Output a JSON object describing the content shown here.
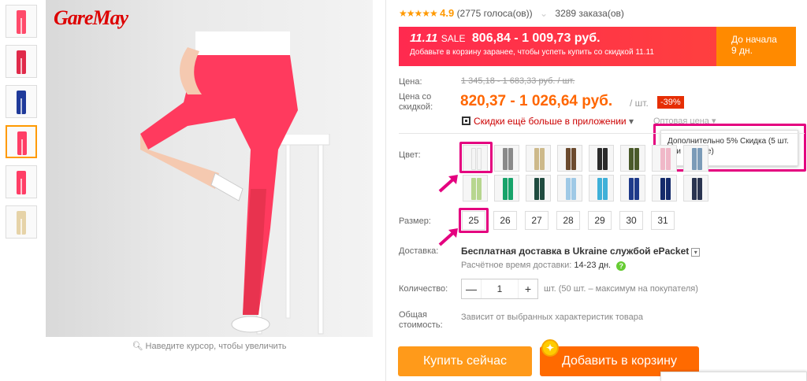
{
  "brand": "GareMay",
  "zoom_hint": "Наведите курсор, чтобы увеличить",
  "rating": {
    "stars": "★★★★★",
    "score": "4.9",
    "votes": "(2775 голоса(ов))",
    "orders": "3289 заказа(ов)"
  },
  "sale": {
    "badge": "11.11",
    "sale_label": "SALE",
    "price": "806,84 - 1 009,73 руб.",
    "subtitle": "Добавьте в корзину заранее, чтобы успеть купить со скидкой 11.11",
    "countdown_label": "До начала",
    "countdown_value": "9 дн."
  },
  "price": {
    "label": "Цена:",
    "old": "1 345,18 - 1 683,33 руб. / шт.",
    "discount_label": "Цена со скидкой:",
    "new": "820,37 - 1 026,64 руб.",
    "unit": "/ шт.",
    "discount_badge": "-39%",
    "app_link": "Скидки ещё больше в приложении",
    "app_link_arrow": "▾",
    "wholesale": "Оптовая цена",
    "wholesale_arrow": "▾"
  },
  "tooltip": {
    "text": "Дополнительно 5% Скидка (5 шт. или больше)"
  },
  "color": {
    "label": "Цвет:",
    "swatches": [
      "#f5f5f5",
      "#8a8a8a",
      "#cdb98a",
      "#6b4a2e",
      "#2b2b2b",
      "#4a5a2a",
      "#f0b8c8",
      "#7b9bb8",
      "#b7d68f",
      "#17a36a",
      "#1f4b3f",
      "#9fc9e6",
      "#3fb0d8",
      "#1e3a8a",
      "#142a6b",
      "#2a3450"
    ]
  },
  "size": {
    "label": "Размер:",
    "options": [
      "25",
      "26",
      "27",
      "28",
      "29",
      "30",
      "31"
    ]
  },
  "shipping": {
    "label": "Доставка:",
    "main": "Бесплатная доставка в Ukraine службой ePacket",
    "dropdown_icon": "chevron-down-icon",
    "time_label": "Расчётное время доставки:",
    "time_value": "14-23 дн.",
    "help_icon": "?"
  },
  "quantity": {
    "label": "Количество:",
    "minus": "—",
    "value": "1",
    "plus": "+",
    "note": "шт. (50 шт. – максимум на покупателя)"
  },
  "total": {
    "label": "Общая стоимость:",
    "note": "Зависит от выбранных характеристик товара"
  },
  "buttons": {
    "buy": "Купить сейчас",
    "cart": "Добавить в корзину",
    "coin": "✦"
  },
  "colors": {
    "accent": "#ff6a00",
    "sale_red": "#ff2a4f",
    "highlight": "#e4007f"
  }
}
